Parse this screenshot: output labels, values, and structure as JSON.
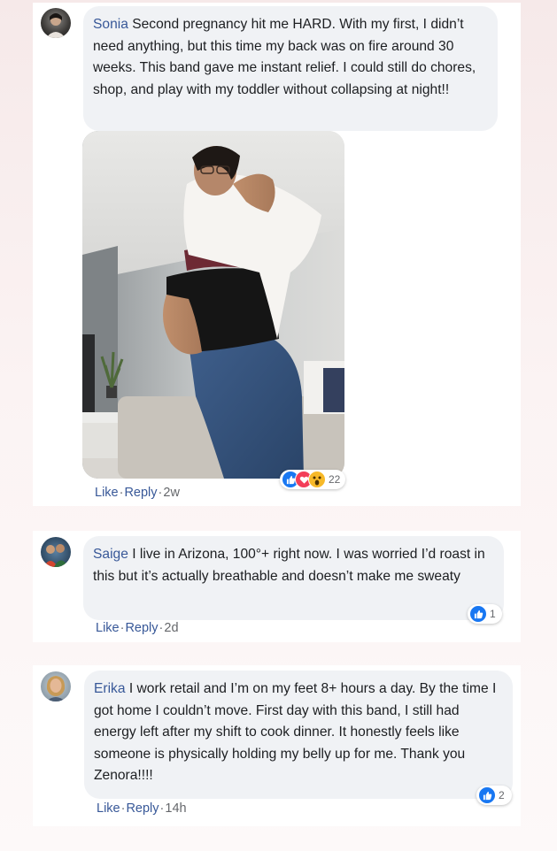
{
  "comments": [
    {
      "author": "Sonia",
      "text": "Second pregnancy hit me HARD. With my first, I didn’t need anything, but this time my back was on fire around 30 weeks. This band gave me instant relief. I could still do chores, shop, and play with my toddler without collapsing at night!!",
      "like_label": "Like",
      "reply_label": "Reply",
      "time": "2w",
      "reaction_count": "22",
      "reaction_icons": [
        "like-icon",
        "love-icon",
        "wow-icon"
      ]
    },
    {
      "author": "Saige",
      "text": "I live in Arizona, 100°+ right now. I was worried I’d roast in this but it’s actually breathable and doesn’t make me sweaty",
      "like_label": "Like",
      "reply_label": "Reply",
      "time": "2d",
      "reaction_count": "1",
      "reaction_icons": [
        "like-icon"
      ]
    },
    {
      "author": "Erika",
      "text": "I work retail and I’m on my feet 8+ hours a day. By the time I got home I couldn’t move. First day with this band, I still had energy left after my shift to cook dinner. It honestly feels like someone is physically holding my belly up for me. Thank you Zenora!!!!",
      "like_label": "Like",
      "reply_label": "Reply",
      "time": "14h",
      "reaction_count": "2",
      "reaction_icons": [
        "like-icon"
      ]
    }
  ],
  "colors": {
    "link": "#385898",
    "bubble": "#f0f2f5",
    "like_blue": "#1877f2",
    "love_red": "#f33e58",
    "wow_yellow": "#f7b928"
  }
}
